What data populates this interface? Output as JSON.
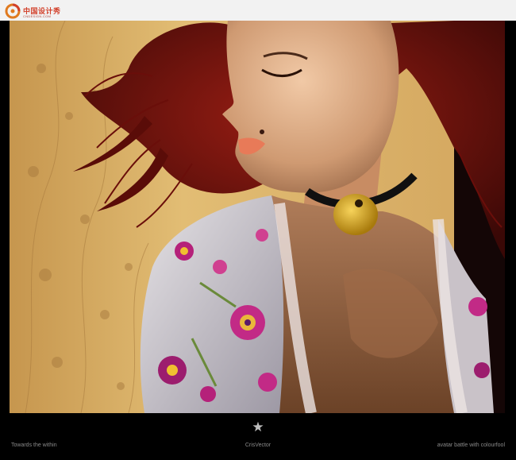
{
  "watermark": {
    "title": "中国设计秀",
    "subtitle": "CNDESIGN.COM",
    "color": "#d2402a"
  },
  "artwork": {
    "background_color": "#d9ad62",
    "hair_color": "#7a1410",
    "skin_color": "#e3b08c",
    "pendant_color": "#d4a417"
  },
  "footer": {
    "left_caption": "Towards the within",
    "center_caption": "CrisVector",
    "right_caption": "avatar battle with colourfool",
    "icon": "star-icon",
    "star_glyph": "★"
  }
}
